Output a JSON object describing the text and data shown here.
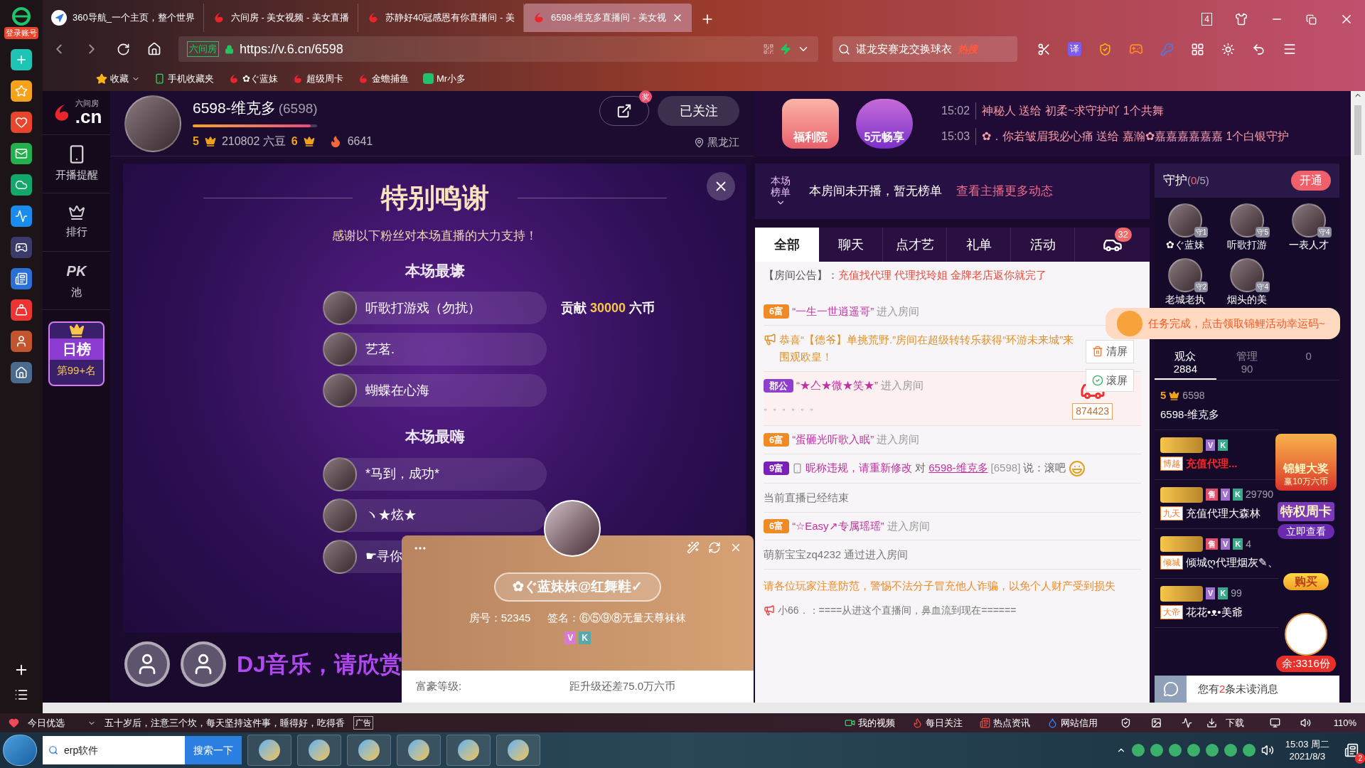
{
  "app_sidebar": {
    "login": "登录账号"
  },
  "browser": {
    "tabs": [
      {
        "title": "360导航_一个主页，整个世界",
        "selected": false,
        "kind": "nav"
      },
      {
        "title": "六间房 - 美女视频 - 美女直播",
        "selected": false,
        "kind": "six"
      },
      {
        "title": "苏静好40冠感恩有你直播间 - 美",
        "selected": false,
        "kind": "six"
      },
      {
        "title": "6598-维克多直播间 - 美女视",
        "selected": true,
        "kind": "six"
      }
    ],
    "tab_count": "4",
    "cert": "六间房",
    "url": "https://v.6.cn/6598",
    "search": {
      "value": "谌龙安赛龙交换球衣",
      "hot": "热搜"
    },
    "translate": "译",
    "bookmarks": [
      {
        "label": "收藏",
        "kind": "star"
      },
      {
        "label": "手机收藏夹",
        "kind": "phone"
      },
      {
        "label": "✿ぐ蓝妹",
        "kind": "six"
      },
      {
        "label": "超级周卡",
        "kind": "six"
      },
      {
        "label": "金蟾捕鱼",
        "kind": "six"
      },
      {
        "label": "Mr小多",
        "kind": "app"
      }
    ]
  },
  "site_nav": {
    "logo_top": "六间房",
    "logo": ".cn",
    "items": [
      {
        "label": "开播提醒",
        "kind": "phone"
      },
      {
        "label": "排行",
        "kind": "crown"
      },
      {
        "label": "池",
        "kind": "pk",
        "mark": "PK"
      }
    ],
    "daily_rank": {
      "title": "日榜",
      "rank": "第99+名"
    }
  },
  "anchor": {
    "name": "6598-维克多",
    "id": "(6598)",
    "rank": "5",
    "beans": "210802 六豆",
    "next_rank": "6",
    "level": 0.95,
    "heat": "6641",
    "share_badge": "奖",
    "follow": "已关注",
    "location": "黑龙江"
  },
  "promos": [
    {
      "label": "福利院"
    },
    {
      "label": "5元畅享"
    }
  ],
  "gift_feed": [
    {
      "time": "15:02",
      "text": "神秘人 送给 初柔~求守护吖 1个共舞"
    },
    {
      "time": "15:03",
      "text": "✿．你若皱眉我必心痛 送给 嘉瀚✿嘉嘉嘉嘉嘉嘉 1个白银守护"
    }
  ],
  "thanks_panel": {
    "title": "特别鸣谢",
    "subtitle": "感谢以下粉丝对本场直播的大力支持！",
    "contribution": {
      "label": "贡献",
      "amount": "30000",
      "unit": "六币"
    },
    "sections": [
      {
        "title": "本场最壕",
        "entries": [
          "听歌打游戏（勿扰）",
          "艺茗.",
          "蝴蝶在心海"
        ]
      },
      {
        "title": "本场最嗨",
        "entries": [
          "*马到，成功*",
          "ヽ★炫★",
          "☛寻你"
        ]
      }
    ]
  },
  "user_card": {
    "name": "✿ぐ蓝妹妹@红舞鞋✓",
    "room": "房号：52345",
    "signature": "签名：⑥⑤⑨⑧无量天尊袜袜",
    "tags": [
      "V",
      "K"
    ],
    "wealth": "富豪等级:",
    "upgrade": "距升级还差75.0万六币"
  },
  "overlay_caption": "DJ音乐，请欣赏",
  "rank_bar": {
    "label": "本场榜单",
    "text": "本房间未开播，暂无榜单",
    "link": "查看主播更多动态"
  },
  "chat_tabs": [
    {
      "label": "全部",
      "selected": true
    },
    {
      "label": "聊天",
      "selected": false
    },
    {
      "label": "点才艺",
      "selected": false
    },
    {
      "label": "礼单",
      "selected": false
    },
    {
      "label": "活动",
      "selected": false
    }
  ],
  "car_badge": "32",
  "announcement": {
    "label": "【房间公告】：",
    "text": "充值找代理 代理找玲姐 金牌老店返你就完了"
  },
  "chat": [
    {
      "kind": "enter",
      "badge": "6富",
      "color": "#f08a24",
      "name": "“一生一世逍遥哥”",
      "suffix": "进入房间"
    },
    {
      "kind": "broadcast",
      "text": "恭喜“【德爷】单挑荒野.”房间在超级转转乐获得“环游未来城”来围观欧皇！"
    },
    {
      "kind": "enter",
      "badge": "郡公",
      "color": "#8e3fd0",
      "name": "“★亼★微★笑★”",
      "suffix": "进入房间",
      "extra": "。。。。。。",
      "gift": "874423"
    },
    {
      "kind": "enter",
      "badge": "6富",
      "color": "#f08a24",
      "name": "“蛋砸光听歌入眠”",
      "suffix": "进入房间"
    },
    {
      "kind": "say",
      "badge": "9富",
      "color": "#7a1fb8",
      "name": "昵称违规，请重新修改",
      "to": "对",
      "target": "6598-维克多",
      "target_id": "[6598]",
      "verb": "说：",
      "text": "滚吧"
    },
    {
      "kind": "plain",
      "text": "当前直播已经结束"
    },
    {
      "kind": "enter",
      "badge": "6富",
      "color": "#f08a24",
      "name": "“☆Easy↗专属瑶瑶”",
      "suffix": "进入房间"
    },
    {
      "kind": "plain",
      "text": "萌新宝宝zq4232 通过进入房间"
    }
  ],
  "chat_notice": "请各位玩家注意防范，警惕不法分子冒充他人诈骗，以免个人财产受到损失",
  "chat_last": "小66．：====从进这个直播间，鼻血流到现在======",
  "chat_tools": [
    "清屏",
    "滚屏"
  ],
  "task_popup": "任务完成，点击领取锦鲤活动幸运码~",
  "guard": {
    "title": "守护",
    "count_open": "(",
    "count": "0",
    "total": "/5)",
    "open": "开通",
    "members": [
      {
        "name": "✿ぐ蓝妹",
        "badge": "守",
        "rank": "1"
      },
      {
        "name": "听歌打游",
        "badge": "守",
        "rank": "5"
      },
      {
        "name": "一表人才",
        "badge": "守",
        "rank": "4"
      },
      {
        "name": "老城老执",
        "badge": "守",
        "rank": "2"
      },
      {
        "name": "烟头的美",
        "badge": "守",
        "rank": "4"
      }
    ]
  },
  "viewer_tabs": [
    {
      "label": "观众",
      "count": "2884",
      "selected": true
    },
    {
      "label": "管理",
      "count": "90",
      "selected": false
    },
    {
      "count": "0",
      "selected": false
    }
  ],
  "viewers": [
    {
      "rank": "5",
      "number": "6598",
      "name": "6598-维克多"
    },
    {
      "badge": "博越",
      "name": "充值代理...",
      "highlight": true,
      "tags": [
        "V",
        "K"
      ]
    },
    {
      "badge": "九天",
      "name": "充值代理大森林",
      "number": "29790",
      "tags": [
        "售",
        "V",
        "K"
      ]
    },
    {
      "badge": "倾城",
      "name": "倾城ღ代理烟灰✎、",
      "number": "4",
      "tags": [
        "售",
        "V",
        "K"
      ]
    },
    {
      "badge": "大帝",
      "name": "花花•ᴥ•美爺",
      "number": "99",
      "tags": [
        "V",
        "K"
      ]
    }
  ],
  "side_promos": {
    "koi": "锦鲤大奖",
    "koi_sub": "赢10万六币",
    "card": "特权周卡",
    "card_btn": "立即查看",
    "buy": "购买",
    "left": "余:3316份"
  },
  "unread": {
    "before": "您有",
    "count": "2",
    "after": "条未读消息"
  },
  "status_bar": {
    "pick": "今日优选",
    "news": "五十岁后，注意三个坎，每天坚持这件事，睡得好，吃得香",
    "ad": "广告",
    "links": [
      {
        "label": "我的视频",
        "kind": "video"
      },
      {
        "label": "每日关注",
        "kind": "flame"
      },
      {
        "label": "热点资讯",
        "kind": "news"
      },
      {
        "label": "网站信用",
        "kind": "drop"
      }
    ],
    "download": "下载",
    "zoom": "110%"
  },
  "taskbar": {
    "search": "erp软件",
    "search_button": "搜索一下",
    "time": "15:03 周二",
    "date": "2021/8/3",
    "notifications": "2"
  }
}
